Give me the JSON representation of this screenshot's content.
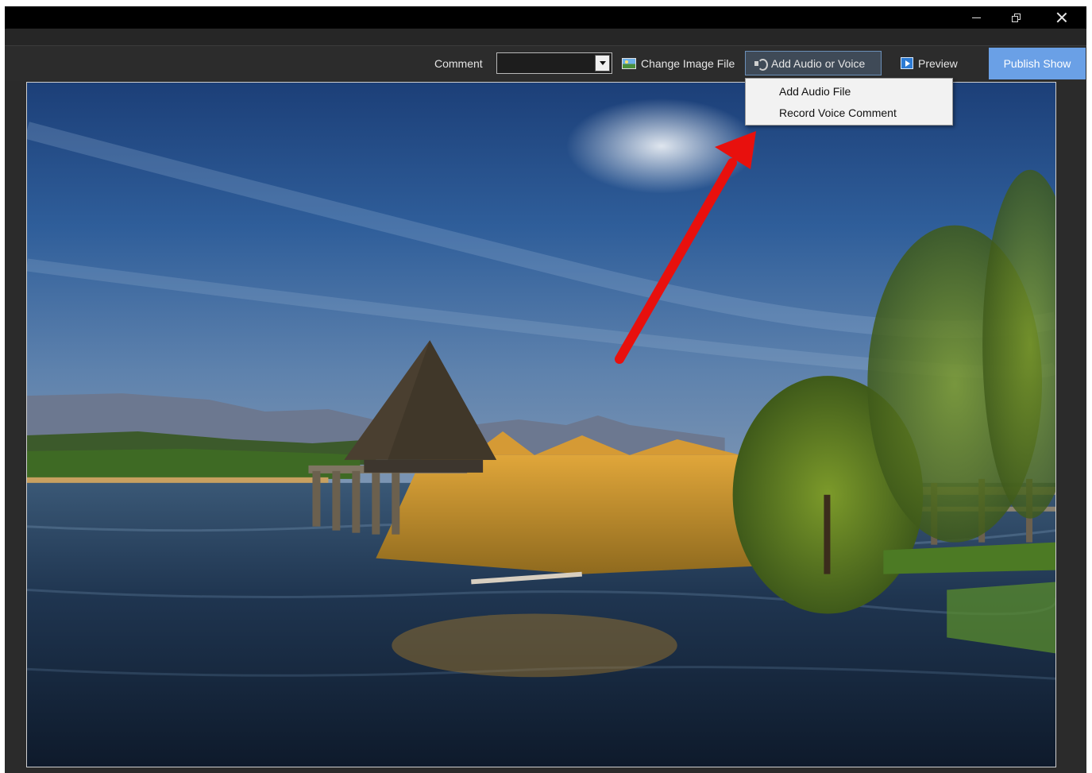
{
  "toolbar": {
    "comment_label": "Comment",
    "comment_value": "",
    "change_image_label": "Change Image File",
    "add_audio_label": "Add Audio or Voice",
    "preview_label": "Preview",
    "publish_label": "Publish Show"
  },
  "dropdown_menu": {
    "items": [
      {
        "label": "Add Audio File"
      },
      {
        "label": "Record Voice Comment"
      }
    ]
  },
  "colors": {
    "publish_button": "#6aa0e6",
    "annotation_arrow": "#e8100d",
    "window_background": "#2b2b2b"
  },
  "icons": {
    "change_image": "image-icon",
    "add_audio": "audio-icon",
    "preview": "play-icon"
  }
}
